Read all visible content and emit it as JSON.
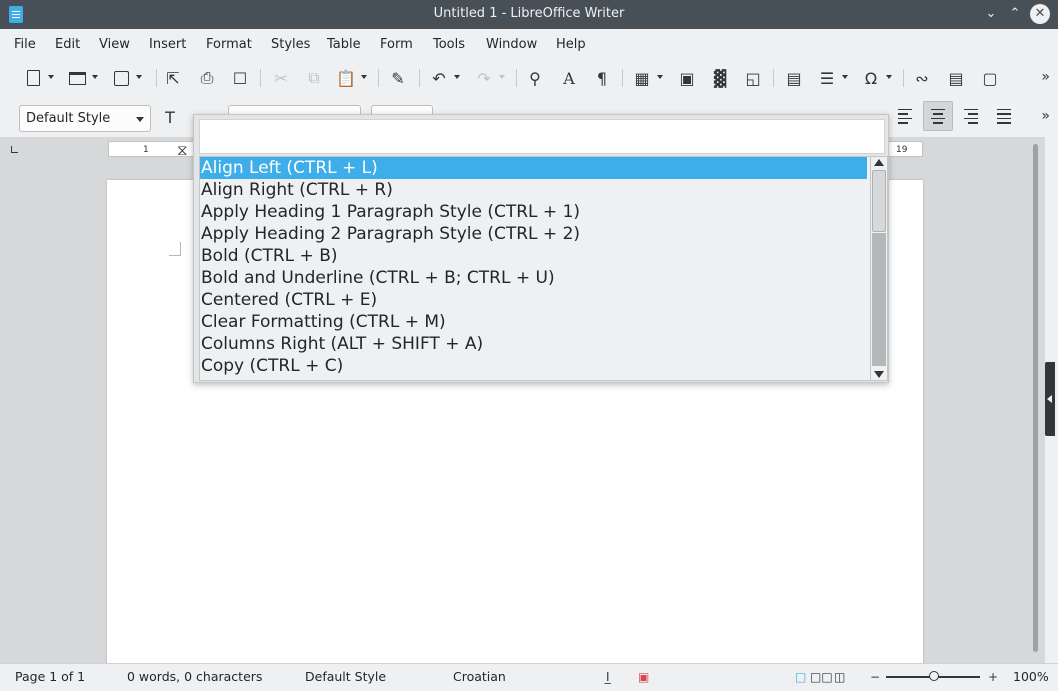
{
  "window": {
    "title": "Untitled 1 - LibreOffice Writer"
  },
  "menu": [
    "File",
    "Edit",
    "View",
    "Insert",
    "Format",
    "Styles",
    "Table",
    "Form",
    "Tools",
    "Window",
    "Help"
  ],
  "toolbar": {
    "paragraph_style": "Default Style"
  },
  "ruler": {
    "ticks": [
      "1",
      "19"
    ]
  },
  "popup": {
    "search_value": "",
    "items": [
      "Align Left (CTRL + L)",
      "Align Right (CTRL + R)",
      "Apply Heading 1 Paragraph Style (CTRL + 1)",
      "Apply Heading 2 Paragraph Style (CTRL + 2)",
      "Bold (CTRL + B)",
      "Bold and Underline (CTRL + B; CTRL + U)",
      "Centered (CTRL + E)",
      "Clear Formatting (CTRL + M)",
      "Columns Right (ALT + SHIFT + A)",
      "Copy (CTRL + C)"
    ],
    "selected_index": 0
  },
  "status": {
    "page": "Page 1 of 1",
    "words": "0 words, 0 characters",
    "style": "Default Style",
    "language": "Croatian",
    "zoom": "100%"
  },
  "colors": {
    "selection": "#3daee9",
    "titlebar": "#475057"
  }
}
